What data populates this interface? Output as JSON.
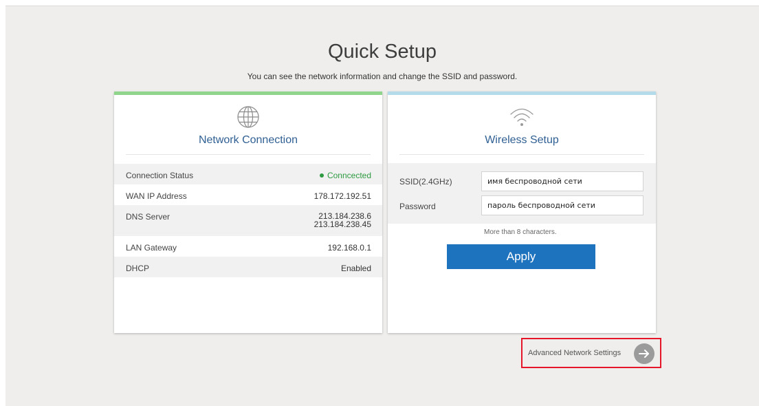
{
  "page": {
    "title": "Quick Setup",
    "subtitle": "You can see the network information and change the SSID and password."
  },
  "network": {
    "icon": "globe-icon",
    "title": "Network Connection",
    "accent": "#8fd68c",
    "rows": [
      {
        "label": "Connection Status",
        "value": "Conncected",
        "status_color": "#2e9a41"
      },
      {
        "label": "WAN IP Address",
        "value": "178.172.192.51"
      },
      {
        "label": "DNS Server",
        "values": [
          "213.184.238.6",
          "213.184.238.45"
        ]
      },
      {
        "label": "LAN Gateway",
        "value": "192.168.0.1"
      },
      {
        "label": "DHCP",
        "value": "Enabled"
      }
    ]
  },
  "wireless": {
    "icon": "wifi-icon",
    "title": "Wireless Setup",
    "accent": "#b4dbe9",
    "ssid_label": "SSID(2.4GHz)",
    "ssid_value": "имя беспроводной сети",
    "password_label": "Password",
    "password_value": "пароль беспроводной сети",
    "hint": "More than 8 characters.",
    "apply_label": "Apply",
    "apply_color": "#1e73be"
  },
  "advanced": {
    "label": "Advanced Network Settings",
    "icon": "arrow-right-icon",
    "highlight_color": "#e5162a"
  }
}
